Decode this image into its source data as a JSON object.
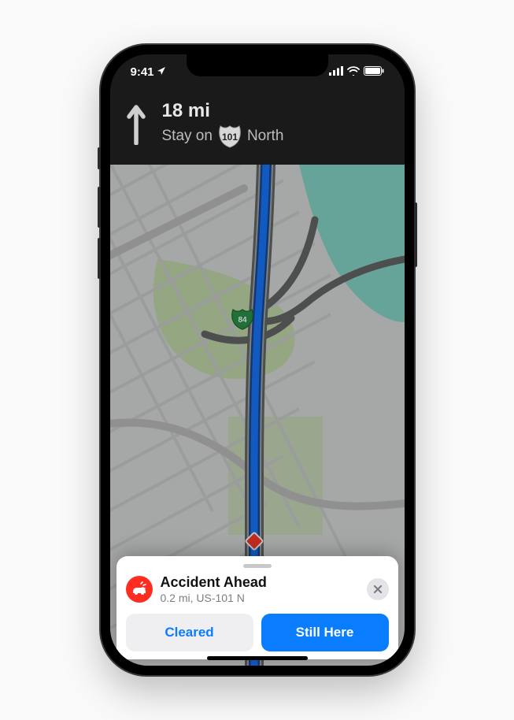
{
  "status": {
    "time": "9:41",
    "location_active": true
  },
  "navigation": {
    "distance": "18 mi",
    "instruction_prefix": "Stay on",
    "route_shield": "101",
    "instruction_suffix": "North"
  },
  "map": {
    "interchange_shield": "84"
  },
  "incident": {
    "title": "Accident Ahead",
    "subtitle": "0.2 mi, US-101 N",
    "actions": {
      "cleared": "Cleared",
      "still_here": "Still Here"
    }
  },
  "colors": {
    "route": "#0a6efb",
    "route_outline": "#0b3f8e",
    "accent": "#0a7dff",
    "incident": "#ff2d1f",
    "water": "#7fd5c6",
    "land": "#d7d9d8",
    "park": "#b8d89a",
    "road_major": "#b7b9b8",
    "road_hwy": "#5c5e5d"
  }
}
